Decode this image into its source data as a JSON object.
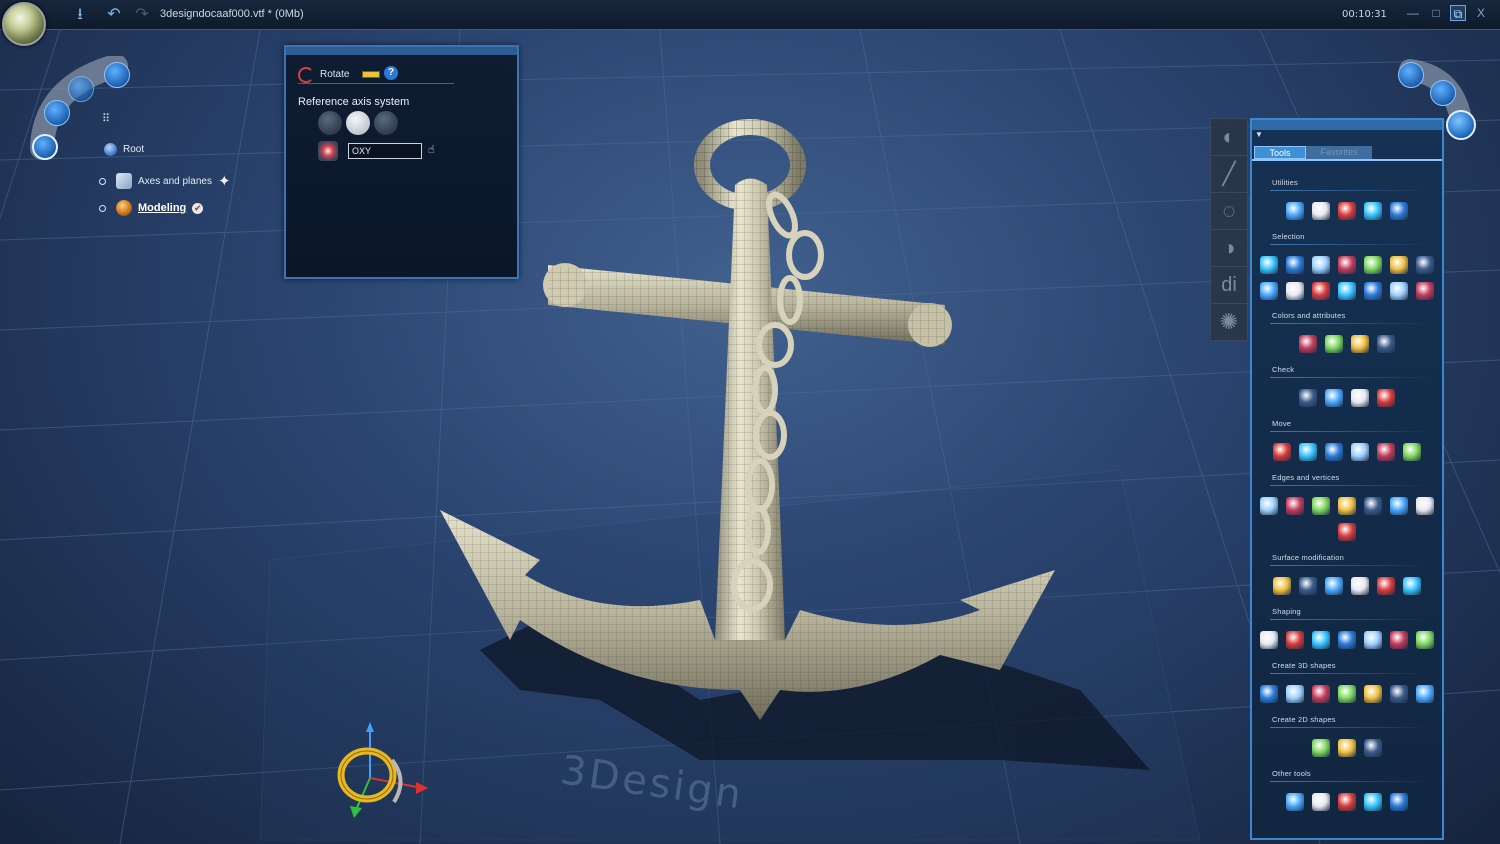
{
  "titlebar": {
    "document_title": "3designdocaaf000.vtf * (0Mb)",
    "timer": "00:10:31",
    "icons": [
      "save-icon",
      "undo-icon",
      "redo-icon"
    ],
    "window_buttons": [
      "minimize-icon",
      "maximize-icon",
      "restore-icon",
      "close-icon"
    ],
    "close_label": "X"
  },
  "tree": {
    "grid_icon": "grid-icon",
    "items": [
      {
        "label": "Root",
        "icon": "globe-icon"
      },
      {
        "label": "Axes and planes",
        "icon": "axes-icon"
      },
      {
        "label": "Modeling",
        "icon": "modeling-icon"
      }
    ]
  },
  "rotate_panel": {
    "title": "Rotate",
    "reference_label": "Reference axis system",
    "axis_value": "OXY",
    "icons": [
      "rotate-icon",
      "ruler-icon",
      "help-icon",
      "axis-system-icon",
      "target-icon",
      "hand-cursor-icon"
    ]
  },
  "tools_panel": {
    "tabs": [
      "Tools",
      "Favorites"
    ],
    "active_tab": "Tools",
    "sections": [
      {
        "label": "Utilities",
        "icon_count": 5
      },
      {
        "label": "Selection",
        "icon_count": 14
      },
      {
        "label": "Colors and attributes",
        "icon_count": 4
      },
      {
        "label": "Check",
        "icon_count": 4
      },
      {
        "label": "Move",
        "icon_count": 6
      },
      {
        "label": "Edges and vertices",
        "icon_count": 8
      },
      {
        "label": "Surface modification",
        "icon_count": 6
      },
      {
        "label": "Shaping",
        "icon_count": 7
      },
      {
        "label": "Create 3D shapes",
        "icon_count": 7
      },
      {
        "label": "Create 2D shapes",
        "icon_count": 3
      },
      {
        "label": "Other tools",
        "icon_count": 5
      }
    ]
  },
  "viewport": {
    "model": "anchor-with-chain",
    "watermark": "3Design"
  },
  "colors": {
    "accent": "#3c86d2",
    "panel_bg": "#112640",
    "viewport_bg": "#2c4673",
    "model_color": "#c9c7b0"
  }
}
